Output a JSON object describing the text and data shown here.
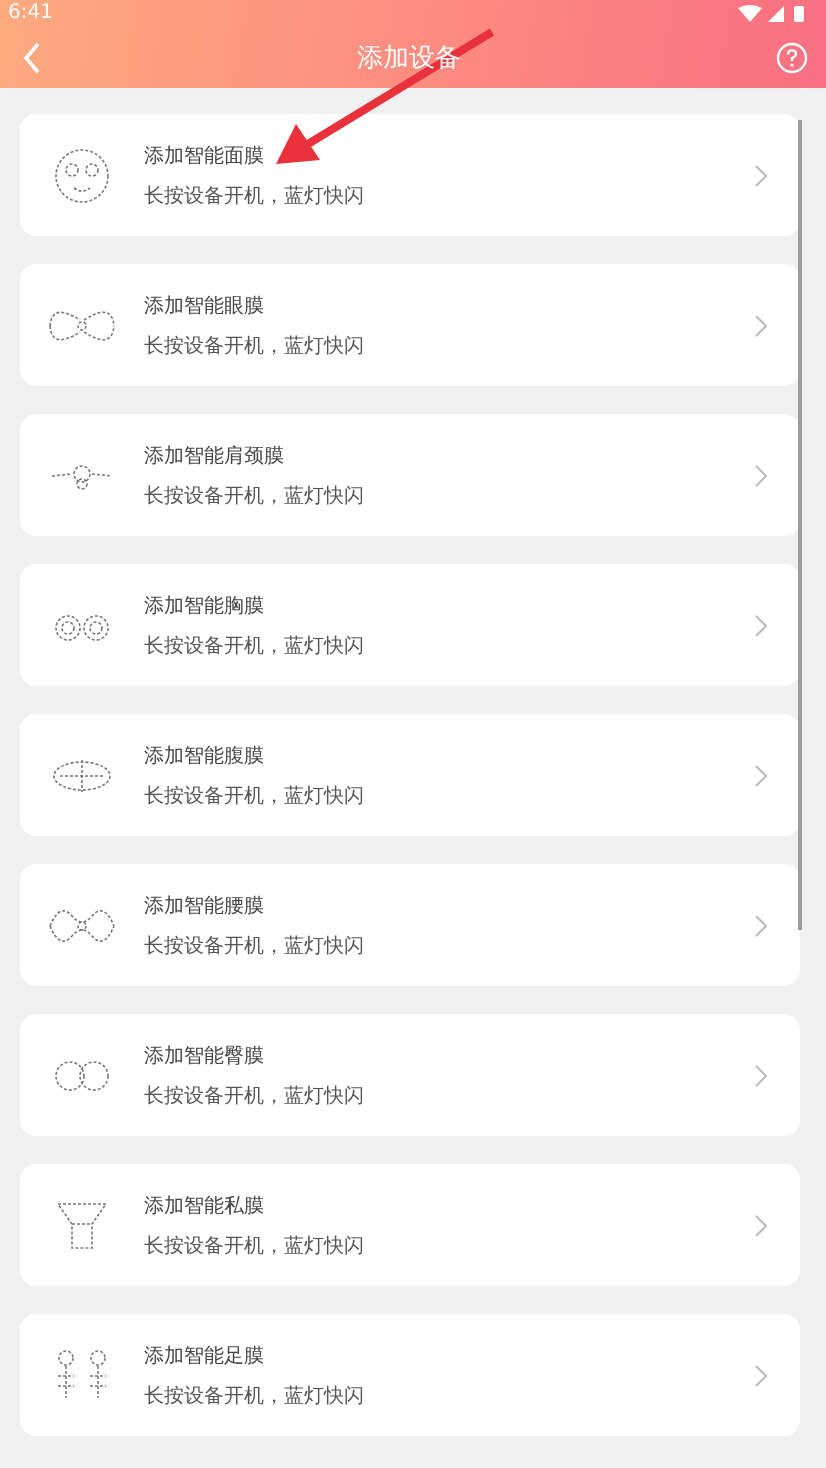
{
  "status_bar": {
    "time": "6:41"
  },
  "header": {
    "title": "添加设备"
  },
  "devices": [
    {
      "kind": "face",
      "title": "添加智能面膜",
      "hint": "长按设备开机，蓝灯快闪"
    },
    {
      "kind": "eye",
      "title": "添加智能眼膜",
      "hint": "长按设备开机，蓝灯快闪"
    },
    {
      "kind": "shoulder",
      "title": "添加智能肩颈膜",
      "hint": "长按设备开机，蓝灯快闪"
    },
    {
      "kind": "chest",
      "title": "添加智能胸膜",
      "hint": "长按设备开机，蓝灯快闪"
    },
    {
      "kind": "abdomen",
      "title": "添加智能腹膜",
      "hint": "长按设备开机，蓝灯快闪"
    },
    {
      "kind": "waist",
      "title": "添加智能腰膜",
      "hint": "长按设备开机，蓝灯快闪"
    },
    {
      "kind": "hip",
      "title": "添加智能臀膜",
      "hint": "长按设备开机，蓝灯快闪"
    },
    {
      "kind": "private",
      "title": "添加智能私膜",
      "hint": "长按设备开机，蓝灯快闪"
    },
    {
      "kind": "foot",
      "title": "添加智能足膜",
      "hint": "长按设备开机，蓝灯快闪"
    }
  ],
  "annotation": {
    "kind": "arrow"
  }
}
